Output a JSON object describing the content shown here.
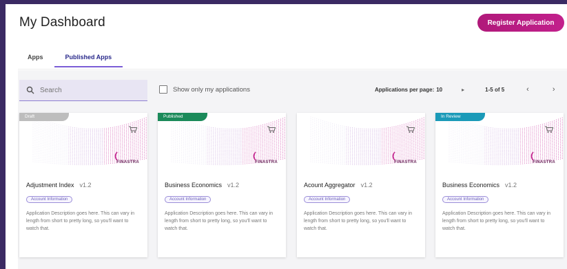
{
  "header": {
    "title": "My Dashboard",
    "register_label": "Register Application"
  },
  "tabs": [
    {
      "label": "Apps"
    },
    {
      "label": "Published Apps"
    }
  ],
  "toolbar": {
    "search_placeholder": "Search",
    "show_mine_label": "Show only my applications",
    "per_page_label": "Applications per page:",
    "per_page_value": "10",
    "range": "1-5 of 5"
  },
  "colors": {
    "accent": "#c2208c",
    "draft": "#bdbdbd",
    "published": "#1b8a5a",
    "in_review": "#1b9ab8"
  },
  "brand_name": "FINASTRA",
  "cards": [
    {
      "status": "Draft",
      "status_color": "#bdbdbd",
      "title": "Adjustment Index",
      "version": "v1.2",
      "tag": "Account Information",
      "description": "Application Description goes here. This can vary in length from short to pretty long, so you'll want to watch that."
    },
    {
      "status": "Published",
      "status_color": "#1b8a5a",
      "title": "Business Economics",
      "version": "v1.2",
      "tag": "Account Information",
      "description": "Application Description goes here. This can vary in length from short to pretty long, so you'll want to watch that."
    },
    {
      "status": "",
      "status_color": "",
      "title": "Acount Aggregator",
      "version": "v1.2",
      "tag": "Account Information",
      "description": "Application Description goes here. This can vary in length from short to pretty long, so you'll want to watch that."
    },
    {
      "status": "In Review",
      "status_color": "#1b9ab8",
      "title": "Business Economics",
      "version": "v1.2",
      "tag": "Account Information",
      "description": "Application Description goes here. This can vary in length from short to pretty long, so you'll want to watch that."
    }
  ]
}
